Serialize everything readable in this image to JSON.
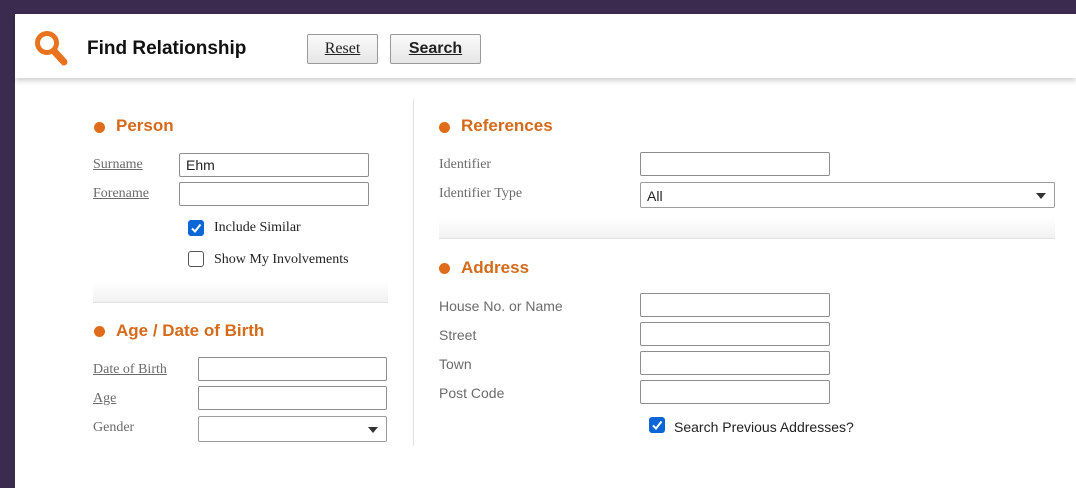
{
  "header": {
    "title": "Find Relationship",
    "reset_label": "Reset",
    "search_label": "Search"
  },
  "person": {
    "title": "Person",
    "surname_label": "Surname",
    "surname_value": "Ehm",
    "forename_label": "Forename",
    "forename_value": "",
    "include_similar_label": "Include Similar",
    "include_similar_checked": true,
    "show_involvements_label": "Show My Involvements",
    "show_involvements_checked": false
  },
  "age": {
    "title": "Age / Date of Birth",
    "dob_label": "Date of Birth",
    "age_label": "Age",
    "gender_label": "Gender",
    "gender_value": ""
  },
  "references": {
    "title": "References",
    "identifier_label": "Identifier",
    "identifier_value": "",
    "identifier_type_label": "Identifier Type",
    "identifier_type_value": "All"
  },
  "address": {
    "title": "Address",
    "house_label": "House No. or Name",
    "street_label": "Street",
    "town_label": "Town",
    "postcode_label": "Post Code",
    "previous_label": "Search Previous Addresses?",
    "previous_checked": true
  },
  "colors": {
    "accent": "#e06c1b",
    "frame": "#3b2b4f",
    "checkbox": "#0b66d8"
  }
}
